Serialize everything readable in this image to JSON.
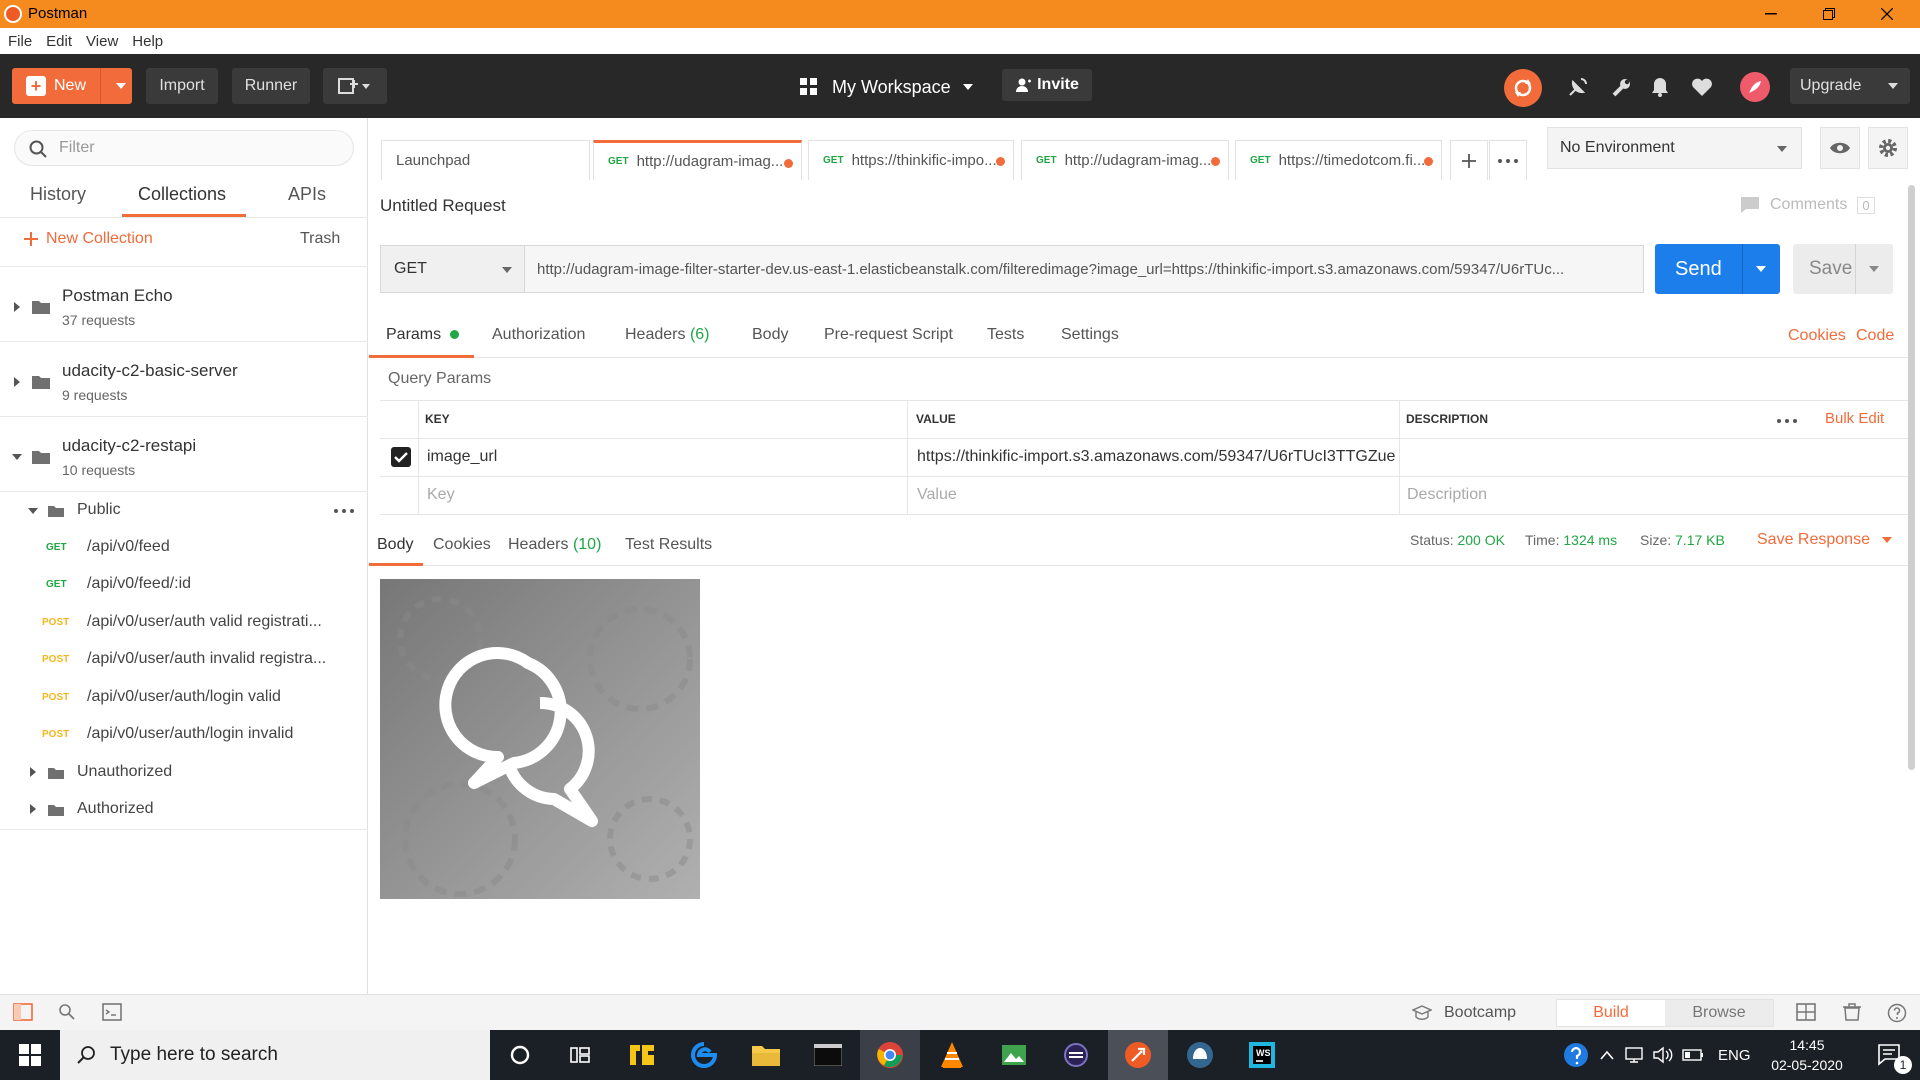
{
  "window": {
    "title": "Postman"
  },
  "menu": [
    "File",
    "Edit",
    "View",
    "Help"
  ],
  "toolbar": {
    "new_label": "New",
    "import_label": "Import",
    "runner_label": "Runner",
    "workspace_label": "My Workspace",
    "invite_label": "Invite",
    "upgrade_label": "Upgrade"
  },
  "sidebar": {
    "filter_placeholder": "Filter",
    "tabs": [
      "History",
      "Collections",
      "APIs"
    ],
    "active_tab": "Collections",
    "new_collection_label": "New Collection",
    "trash_label": "Trash",
    "collections": [
      {
        "name": "Postman Echo",
        "count": "37 requests"
      },
      {
        "name": "udacity-c2-basic-server",
        "count": "9 requests"
      },
      {
        "name": "udacity-c2-restapi",
        "count": "10 requests"
      }
    ],
    "folder_public": "Public",
    "requests": [
      {
        "method": "GET",
        "path": "/api/v0/feed"
      },
      {
        "method": "GET",
        "path": "/api/v0/feed/:id"
      },
      {
        "method": "POST",
        "path": "/api/v0/user/auth valid registrati..."
      },
      {
        "method": "POST",
        "path": "/api/v0/user/auth invalid registra..."
      },
      {
        "method": "POST",
        "path": "/api/v0/user/auth/login valid"
      },
      {
        "method": "POST",
        "path": "/api/v0/user/auth/login invalid"
      }
    ],
    "folder_unauthorized": "Unauthorized",
    "folder_authorized": "Authorized"
  },
  "request_tabs": [
    {
      "method": "",
      "label": "Launchpad"
    },
    {
      "method": "GET",
      "label": "http://udagram-imag..."
    },
    {
      "method": "GET",
      "label": "https://thinkific-impo..."
    },
    {
      "method": "GET",
      "label": "http://udagram-imag..."
    },
    {
      "method": "GET",
      "label": "https://timedotcom.fi..."
    }
  ],
  "environment": {
    "selected": "No Environment"
  },
  "request": {
    "title": "Untitled Request",
    "comments_label": "Comments",
    "comments_count": "0",
    "method": "GET",
    "url": "http://udagram-image-filter-starter-dev.us-east-1.elasticbeanstalk.com/filteredimage?image_url=https://thinkific-import.s3.amazonaws.com/59347/U6rTUc...",
    "send_label": "Send",
    "save_label": "Save"
  },
  "request_subtabs": {
    "params": "Params",
    "authorization": "Authorization",
    "headers": "Headers",
    "headers_count": "(6)",
    "body": "Body",
    "prerequest": "Pre-request Script",
    "tests": "Tests",
    "settings": "Settings",
    "cookies": "Cookies",
    "code": "Code"
  },
  "query_params": {
    "title": "Query Params",
    "col_key": "KEY",
    "col_value": "VALUE",
    "col_description": "DESCRIPTION",
    "bulk_edit": "Bulk Edit",
    "rows": [
      {
        "key": "image_url",
        "value": "https://thinkific-import.s3.amazonaws.com/59347/U6rTUcI3TTGZue",
        "description": ""
      }
    ],
    "key_placeholder": "Key",
    "value_placeholder": "Value",
    "description_placeholder": "Description"
  },
  "response": {
    "tabs": {
      "body": "Body",
      "cookies": "Cookies",
      "headers": "Headers",
      "headers_count": "(10)",
      "tests": "Test Results"
    },
    "status_label": "Status:",
    "status_value": "200 OK",
    "time_label": "Time:",
    "time_value": "1324 ms",
    "size_label": "Size:",
    "size_value": "7.17 KB",
    "save_response": "Save Response"
  },
  "statusbar": {
    "bootcamp": "Bootcamp",
    "build": "Build",
    "browse": "Browse"
  },
  "taskbar": {
    "search_placeholder": "Type here to search",
    "lang": "ENG",
    "time": "14:45",
    "date": "02-05-2020",
    "notifications": "1"
  },
  "colors": {
    "accent": "#f26b3a",
    "send": "#1b7eeb",
    "success": "#21a545",
    "post": "#f1b820"
  }
}
